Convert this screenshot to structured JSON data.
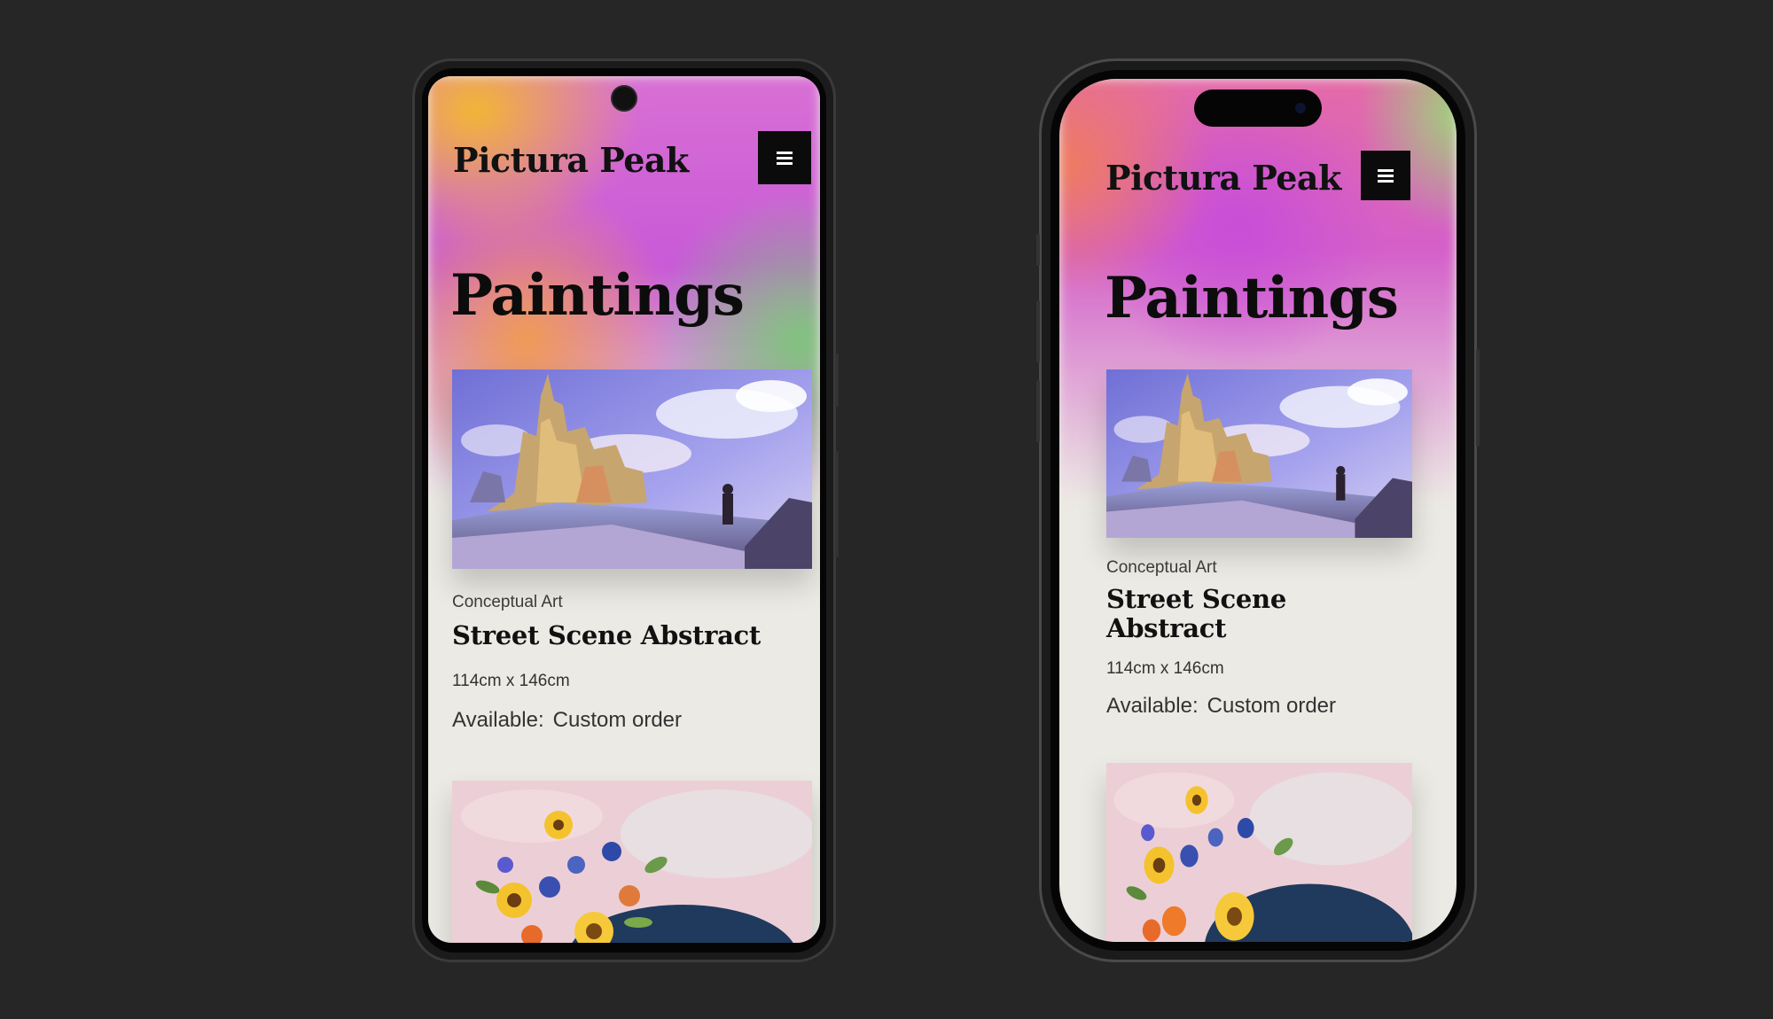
{
  "site": {
    "brand": "Pictura Peak",
    "page_title": "Paintings"
  },
  "artworks": [
    {
      "category": "Conceptual Art",
      "title": "Street Scene Abstract",
      "dimensions": "114cm x 146cm",
      "availability_label": "Available:",
      "availability_value": "Custom order",
      "image": "castle-landscape-painting"
    },
    {
      "image": "flower-bouquet-painting"
    }
  ],
  "icons": {
    "menu": "hamburger-menu-icon"
  },
  "colors": {
    "background": "#262626",
    "menu_button": "#0b0b0b",
    "text": "#111111"
  }
}
